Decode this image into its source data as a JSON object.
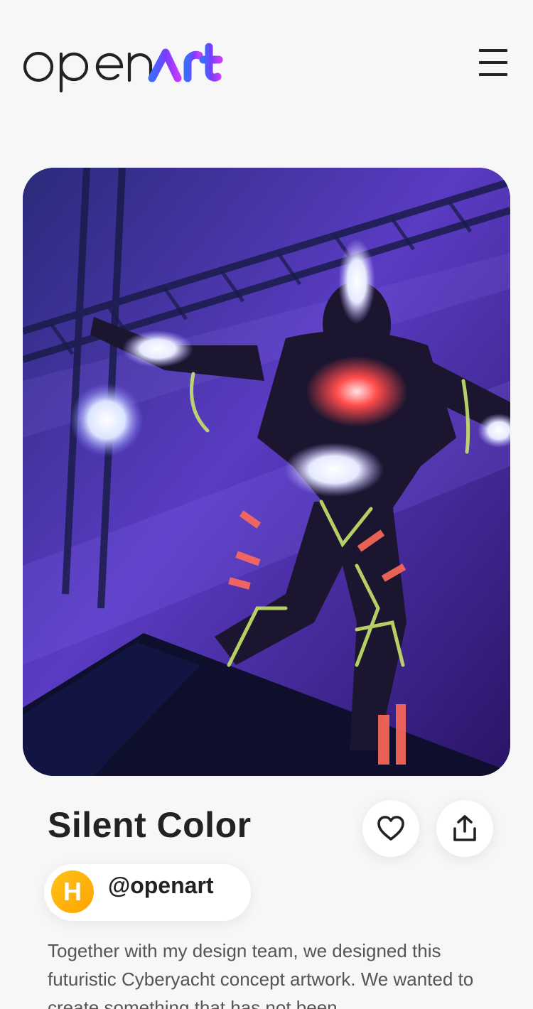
{
  "header": {
    "logo_text": "openArt",
    "menu_icon": "hamburger-menu-icon"
  },
  "artwork": {
    "alt": "Performer in an LED light-up costume on stage under purple lights",
    "accent_colors": [
      "#3a2a9c",
      "#6b4fd8",
      "#ff4b4b",
      "#c8e36a"
    ]
  },
  "item": {
    "title": "Silent Color",
    "creator_initial": "H",
    "creator_handle": "@openart",
    "description": "Together with my design team, we designed this futuristic Cyberyacht concept artwork. We wanted to create something that has not been"
  },
  "actions": {
    "like_icon": "heart-icon",
    "share_icon": "share-icon"
  },
  "colors": {
    "background": "#f7f7f7",
    "logo_gradient": [
      "#3b6cff",
      "#7a3cff",
      "#c13cff"
    ],
    "avatar": "#ffb300"
  }
}
